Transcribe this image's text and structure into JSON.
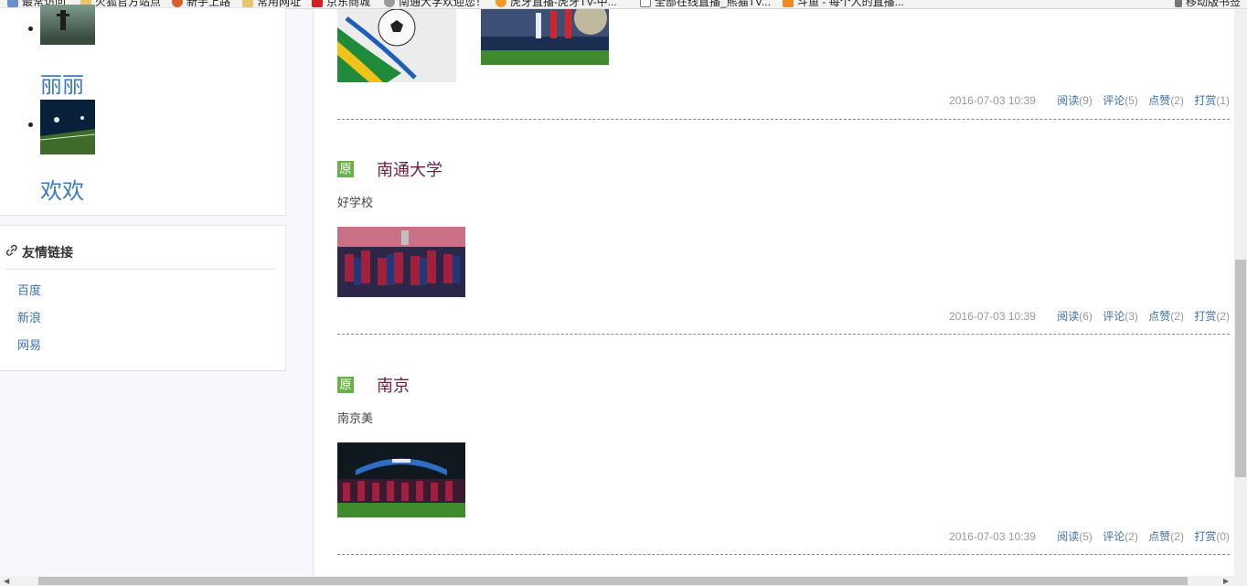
{
  "bookmarks": [
    {
      "label": "最常访问",
      "icon": "page-icon"
    },
    {
      "label": "火狐官方站点",
      "icon": "folder-icon"
    },
    {
      "label": "新手上路",
      "icon": "firefox-icon"
    },
    {
      "label": "常用网址",
      "icon": "folder-icon"
    },
    {
      "label": "京东商城",
      "icon": "jd-icon"
    },
    {
      "label": "南通大学欢迎您！",
      "icon": "globe-icon"
    },
    {
      "label": "虎牙直播-虎牙TV-中...",
      "icon": "huya-icon"
    },
    {
      "label": "全部在线直播_熊猫TV...",
      "icon": "tv-icon"
    },
    {
      "label": "斗鱼 - 每个人的直播...",
      "icon": "douyu-icon"
    },
    {
      "label": "移动版书签",
      "icon": "mobile-icon"
    }
  ],
  "sidebar": {
    "photos": [
      {
        "caption": "丽丽"
      },
      {
        "caption": "欢欢"
      }
    ],
    "links": {
      "title": "友情链接",
      "items": [
        "百度",
        "新浪",
        "网易"
      ]
    }
  },
  "posts": [
    {
      "badge": "",
      "title": "",
      "summary": "",
      "date": "2016-07-03 10:39",
      "read_label": "阅读",
      "read": "(9)",
      "comment_label": "评论",
      "comment": "(5)",
      "like_label": "点赞",
      "like": "(2)",
      "tip_label": "打赏",
      "tip": "(1)"
    },
    {
      "badge": "原",
      "title": "南通大学",
      "summary": "好学校",
      "date": "2016-07-03 10:39",
      "read_label": "阅读",
      "read": "(6)",
      "comment_label": "评论",
      "comment": "(3)",
      "like_label": "点赞",
      "like": "(2)",
      "tip_label": "打赏",
      "tip": "(2)"
    },
    {
      "badge": "原",
      "title": "南京",
      "summary": "南京美",
      "date": "2016-07-03 10:39",
      "read_label": "阅读",
      "read": "(5)",
      "comment_label": "评论",
      "comment": "(2)",
      "like_label": "点赞",
      "like": "(2)",
      "tip_label": "打赏",
      "tip": "(0)"
    }
  ],
  "colors": {
    "badge": "#6ab04c",
    "title": "#6b1f3f",
    "link": "#3b6fa8",
    "caption": "#3b7bbf"
  }
}
